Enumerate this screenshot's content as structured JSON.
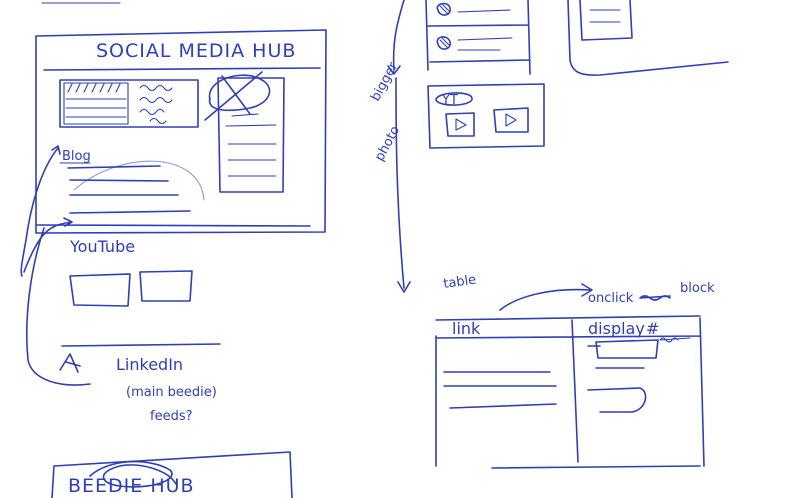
{
  "top_sketch": {
    "title": "SOCIAL MEDIA HUB",
    "blog_label": "Blog",
    "youtube_label": "YouTube",
    "linkedin_label": "LinkedIn",
    "linkedin_note_1": "(main beedie)",
    "linkedin_note_2": "feeds?"
  },
  "side_note": {
    "line_1": "bigger",
    "line_2": "photo"
  },
  "yt_badge": "YT",
  "table_sketch": {
    "label": "table",
    "onclick_label": "onclick",
    "block_label": "block",
    "col_link": "link",
    "col_display": "display",
    "hash": "#"
  },
  "bottom_sketch": {
    "title": "BEEDIE HUB"
  }
}
